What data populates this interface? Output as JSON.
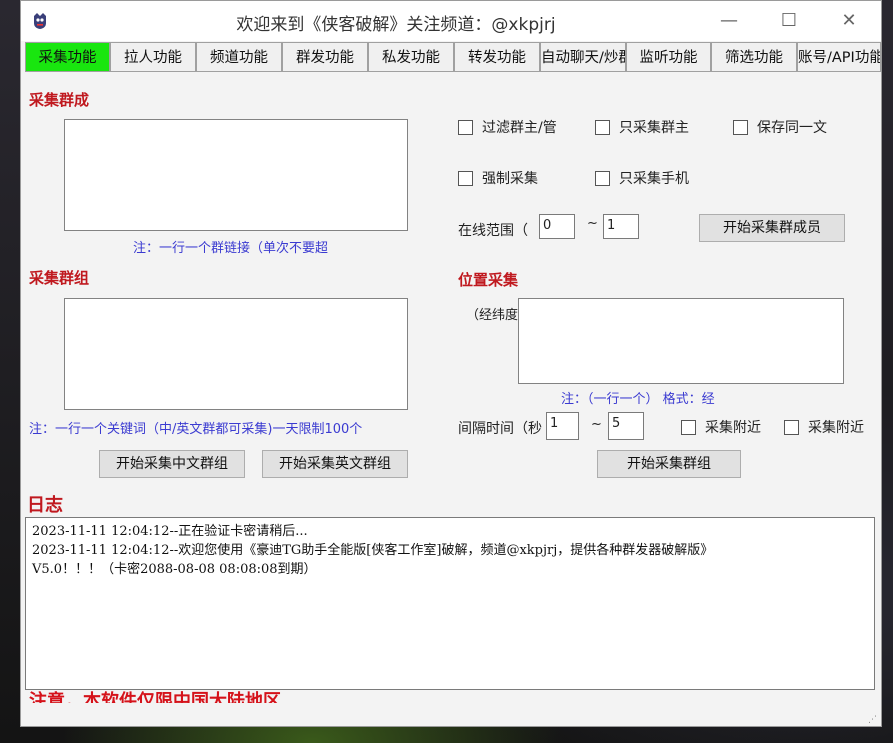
{
  "window": {
    "title": "欢迎来到《侠客破解》关注频道：@xkpjrj",
    "minimize": "—",
    "maximize": "☐",
    "close": "✕"
  },
  "tabs": [
    {
      "label": "采集功能",
      "active": true
    },
    {
      "label": "拉人功能"
    },
    {
      "label": "频道功能"
    },
    {
      "label": "群发功能"
    },
    {
      "label": "私发功能"
    },
    {
      "label": "转发功能"
    },
    {
      "label": "自动聊天/炒群"
    },
    {
      "label": "监听功能"
    },
    {
      "label": "筛选功能"
    },
    {
      "label": "账号/API功能"
    }
  ],
  "collect_members": {
    "title": "采集群成",
    "note": "注：一行一个群链接（单次不要超",
    "checkbox_filter_owner": "过滤群主/管",
    "checkbox_only_owner": "只采集群主",
    "checkbox_save_same": "保存同一文",
    "checkbox_force": "强制采集",
    "checkbox_only_phone": "只采集手机",
    "online_range_label": "在线范围（",
    "range_from": "0",
    "range_sep": "~",
    "range_to": "1",
    "start_button": "开始采集群成员"
  },
  "collect_groups": {
    "title": "采集群组",
    "note": "注：一行一个关键词（中/英文群都可采集)一天限制100个",
    "start_cn_button": "开始采集中文群组",
    "start_en_button": "开始采集英文群组"
  },
  "location_collect": {
    "title": "位置采集",
    "coords_label": "（经纬度",
    "note": "注：（一行一个） 格式：经",
    "interval_label": "间隔时间（秒",
    "interval_from": "1",
    "interval_sep": "~",
    "interval_to": "5",
    "checkbox_nearby1": "采集附近",
    "checkbox_nearby2": "采集附近",
    "start_button": "开始采集群组"
  },
  "log": {
    "title": "日志",
    "lines": [
      "2023-11-11 12:04:12--正在验证卡密请稍后...",
      "2023-11-11 12:04:12--欢迎您使用《豪迪TG助手全能版[侠客工作室]破解，频道@xkpjrj，提供各种群发器破解版》",
      "V5.0！！！（卡密2088-08-08 08:08:08到期）"
    ]
  },
  "warning": "注意，本软件仅限中国大陆地区"
}
